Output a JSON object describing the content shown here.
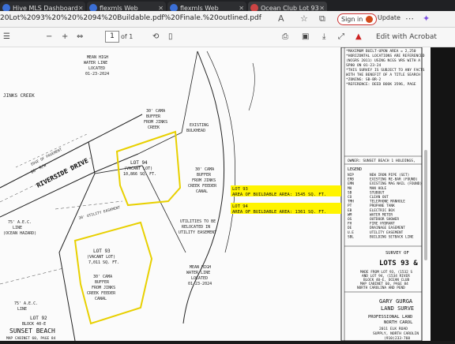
{
  "tabs": [
    {
      "label": "Hive MLS Dashboard"
    },
    {
      "label": "flexmls Web"
    },
    {
      "label": "flexmls Web"
    },
    {
      "label": "Ocean Club Lot 93"
    }
  ],
  "address": {
    "url": "20Lot%2093%20%20%2094%20Buildable.pdf%20Finale.%20outlined.pdf"
  },
  "browser": {
    "signin": "Sign in",
    "update": "Update"
  },
  "pdf": {
    "page": "1",
    "of": "of 1",
    "adobe": "Edit with Acrobat"
  },
  "map": {
    "notes": [
      "*MAXIMUM BUILT-UPON AREA = 2,250",
      "*HORIZONTAL LOCATIONS ARE REFERENCED",
      "(NCGRS 2011) USING NCGS VRS WITH A",
      "SP80 ON 01-23-24",
      "*THIS SURVEY IS SUBJECT TO ANY FACTS",
      "WITH THE BENEFIT OF A TITLE SEARCH",
      "*ZONING: SB-BR-2",
      "*REFERENCE: DEED BOOK 3596, PAGE"
    ],
    "owner": "OWNER: SUNSET BEACH 1 HOLDINGS,",
    "legend_title": "LEGEND",
    "legend": [
      {
        "code": "NIP",
        "desc": "NEW IRON PIPE (SET)"
      },
      {
        "code": "ERB",
        "desc": "EXISTING RE-BAR (FOUND)"
      },
      {
        "code": "EMN",
        "desc": "EXISTING MAG NAIL (FOUND)"
      },
      {
        "code": "MH",
        "desc": "MAN HOLE"
      },
      {
        "code": "SB",
        "desc": "STUBOUT"
      },
      {
        "code": "CO",
        "desc": "CLEAN OUT"
      },
      {
        "code": "TMH",
        "desc": "TELEPHONE MANHOLE"
      },
      {
        "code": "PT",
        "desc": "PROPANE TANK"
      },
      {
        "code": "EB",
        "desc": "ELECTRIC BOX"
      },
      {
        "code": "WM",
        "desc": "WATER METER"
      },
      {
        "code": "OS",
        "desc": "OUTDOOR SHOWER"
      },
      {
        "code": "FH",
        "desc": "FIRE HYDRANT"
      },
      {
        "code": "DE",
        "desc": "DRAINAGE EASEMENT"
      },
      {
        "code": "U.E",
        "desc": "UTILITY EASEMENT"
      },
      {
        "code": "SBL",
        "desc": "BUILDING SETBACK LINE"
      }
    ],
    "survey_of": "SURVEY OF",
    "lots_title": "LOTS 93 &",
    "made_from": [
      "MADE FROM LOT 93, (1532 S",
      "AND LOT 94, (1534 RIVER",
      "BLOCK 40-E, OCEAN CLUB",
      "MAP CABINET 60, PAGE 84",
      "NORTH CAROLINA AND PEND"
    ],
    "surveyor": [
      "GARY GURGA",
      "LAND SURVE",
      "PROFESSIONAL LAND",
      "NORTH CAROL"
    ],
    "surveyor_addr": [
      "2011 ELK ROAD",
      "SUPPLY, NORTH CAROLIN",
      "(910)233-760"
    ],
    "labels": {
      "mean_high_top": [
        "MEAN HIGH",
        "WATER LINE",
        "LOCATED",
        "01-23-2024"
      ],
      "jinks_creek": "JINKS CREEK",
      "cama_top": [
        "30' CAMA",
        "BUFFER",
        "FROM JINKS",
        "CREEK"
      ],
      "bulkhead": [
        "EXISTING",
        "BULKHEAD"
      ],
      "riverside": "RIVERSIDE DRIVE",
      "row": "60' R/W",
      "edge_pavement": "EDGE OF PAVEMENT",
      "lot94": [
        "LOT 94",
        "(VACANT LOT)",
        "10,866 SQ. FT."
      ],
      "cama_mid": [
        "30' CAMA",
        "BUFFER",
        "FROM JINKS",
        "CREEK FEEDER",
        "CANAL"
      ],
      "utilities": [
        "UTILITIES TO BE",
        "RELOCATED IN",
        "UTILITY EASEMENT"
      ],
      "util_easement": "30' UTILITY EASEMENT",
      "lot93": [
        "LOT 93",
        "(VACANT LOT)",
        "7,011 SQ. FT."
      ],
      "cama_low": [
        "30' CAMA",
        "BUFFER",
        "FROM JINKS",
        "CREEK FEEDER",
        "CANAL"
      ],
      "mean_high_low": [
        "MEAN HIGH",
        "WATER LINE",
        "LOCATED",
        "01-23-2024"
      ],
      "aec_top": [
        "75' A.E.C.",
        "LINE",
        "(OCEAN HAZARD)"
      ],
      "aec_low": [
        "75' A.E.C.",
        "LINE"
      ],
      "lot92": [
        "LOT 92",
        "BLOCK 40-E",
        "MAP CABINET 60, PAGE 84"
      ],
      "sunset_beach": "SUNSET BEACH"
    },
    "callouts": [
      {
        "line1": "LOT 93",
        "line2": "AREA OF BUILDABLE AREA: 1545 SQ. FT."
      },
      {
        "line1": "LOT 94",
        "line2": "AREA OF BUILDABLE AREA: 1361 SQ. FT."
      }
    ]
  }
}
